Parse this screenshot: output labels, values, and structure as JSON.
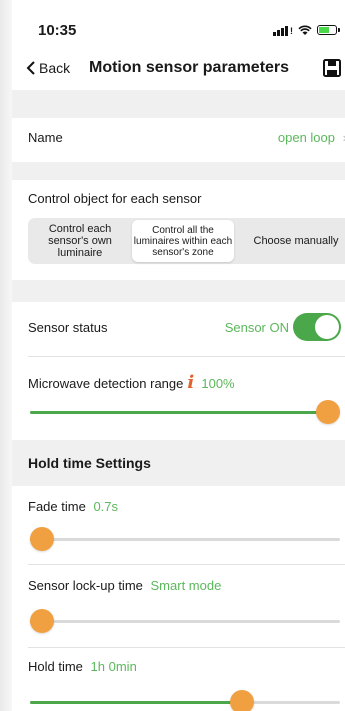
{
  "status_bar": {
    "time": "10:35"
  },
  "nav": {
    "back_label": "Back",
    "title": "Motion sensor parameters",
    "save_icon": "floppy-disk-icon"
  },
  "name_row": {
    "label": "Name",
    "value": "open loop"
  },
  "control_object": {
    "label": "Control object for each sensor",
    "options": [
      {
        "label": "Control each sensor's own luminaire",
        "selected": false
      },
      {
        "label": "Control all the luminaires within each sensor's zone",
        "selected": true
      },
      {
        "label": "Choose manually",
        "selected": false
      }
    ]
  },
  "sensor_status": {
    "label": "Sensor status",
    "value": "Sensor ON",
    "on": true
  },
  "microwave": {
    "label": "Microwave detection range",
    "value": "100%",
    "level": 1.0
  },
  "hold_section": {
    "title": "Hold time Settings"
  },
  "fade_time": {
    "label": "Fade time",
    "value": "0.7s",
    "level": 0.0
  },
  "lockup_time": {
    "label": "Sensor lock-up time",
    "value": "Smart mode",
    "level": 0.0
  },
  "hold_time": {
    "label": "Hold time",
    "value": "1h 0min",
    "level": 0.7
  },
  "colors": {
    "accent_green": "#4aa84a",
    "text_green": "#5cb85c",
    "thumb_orange": "#f0a040",
    "info_orange": "#e0622c"
  }
}
